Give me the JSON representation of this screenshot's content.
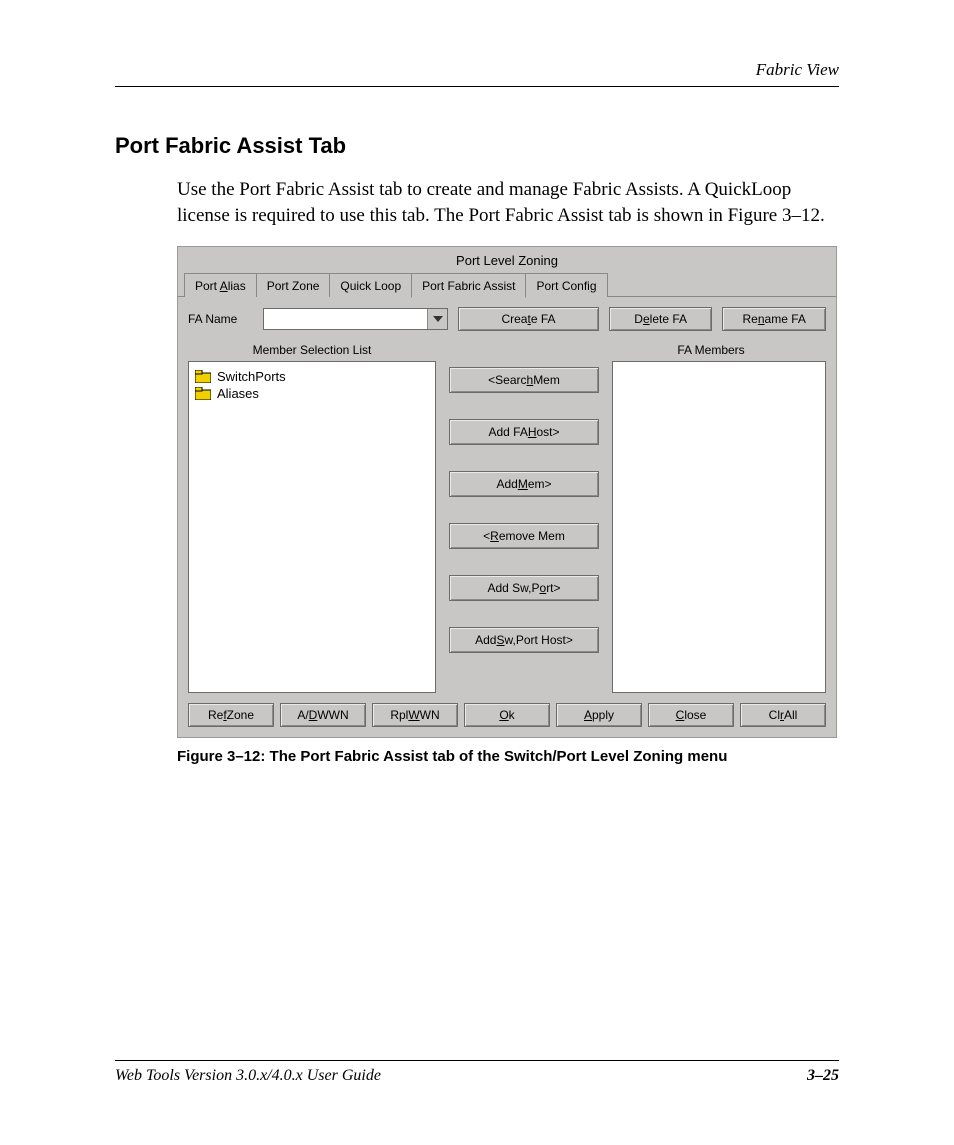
{
  "header": {
    "running_head": "Fabric View"
  },
  "section": {
    "title": "Port Fabric Assist Tab",
    "body": "Use the Port Fabric Assist tab to create and manage Fabric Assists. A QuickLoop license is required to use this tab. The Port Fabric Assist tab is shown in Figure 3–12."
  },
  "app": {
    "title": "Port Level Zoning",
    "tabs": [
      {
        "label": "Port Alias",
        "underline_index": 5,
        "active": false
      },
      {
        "label": "Port Zone",
        "underline_index": -1,
        "active": false
      },
      {
        "label": "Quick Loop",
        "underline_index": -1,
        "active": false
      },
      {
        "label": "Port Fabric Assist",
        "underline_index": -1,
        "active": true
      },
      {
        "label": "Port Config",
        "underline_index": 10,
        "active": false
      }
    ],
    "fa_name_label": "FA Name",
    "fa_name_value": "",
    "top_buttons": {
      "create": "Create FA",
      "create_u": "t",
      "delete": "Delete FA",
      "delete_u": "e",
      "rename": "Rename FA",
      "rename_u": "n"
    },
    "list_headers": {
      "left": "Member Selection List",
      "right": "FA Members"
    },
    "left_list": [
      {
        "label": "SwitchPorts"
      },
      {
        "label": "Aliases"
      }
    ],
    "mid_buttons": [
      {
        "key": "search",
        "pre": "<Searc",
        "u": "h",
        "post": " Mem"
      },
      {
        "key": "addfahost",
        "pre": "Add FA ",
        "u": "H",
        "post": "ost>"
      },
      {
        "key": "addmem",
        "pre": "Add ",
        "u": "M",
        "post": "em>"
      },
      {
        "key": "removemem",
        "pre": "<",
        "u": "R",
        "post": "emove Mem"
      },
      {
        "key": "addswport",
        "pre": "Add Sw,P",
        "u": "o",
        "post": "rt>"
      },
      {
        "key": "addswporthost",
        "pre": "Add ",
        "u": "S",
        "post": "w,Port Host>"
      }
    ],
    "bottom_buttons": [
      {
        "key": "refzone",
        "pre": "Re",
        "u": "f",
        "post": " Zone"
      },
      {
        "key": "adwwn",
        "pre": "A/",
        "u": "D",
        "post": " WWN"
      },
      {
        "key": "rplwwn",
        "pre": "Rpl ",
        "u": "W",
        "post": "WN"
      },
      {
        "key": "ok",
        "pre": "",
        "u": "O",
        "post": "k"
      },
      {
        "key": "apply",
        "pre": "",
        "u": "A",
        "post": "pply"
      },
      {
        "key": "close",
        "pre": "",
        "u": "C",
        "post": "lose"
      },
      {
        "key": "clrall",
        "pre": "Cl",
        "u": "r",
        "post": " All"
      }
    ]
  },
  "caption": "Figure 3–12:  The Port Fabric Assist tab of the Switch/Port Level Zoning menu",
  "footer": {
    "left": "Web Tools Version 3.0.x/4.0.x User Guide",
    "right": "3–25"
  }
}
